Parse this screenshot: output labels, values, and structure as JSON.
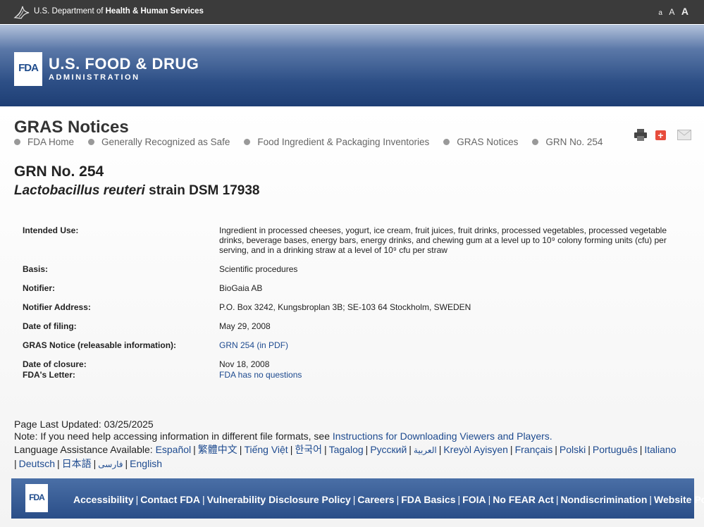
{
  "topbar": {
    "dept_prefix": "U.S. Department of ",
    "dept_name": "Health & Human Services",
    "font_sizes": [
      "a",
      "A",
      "A"
    ]
  },
  "banner": {
    "logo_text": "FDA",
    "title": "U.S. FOOD & DRUG",
    "subtitle": "ADMINISTRATION"
  },
  "page": {
    "title": "GRAS Notices",
    "breadcrumb": [
      "FDA Home",
      "Generally Recognized as Safe",
      "Food Ingredient & Packaging Inventories",
      "GRAS Notices",
      "GRN No. 254"
    ],
    "tools": [
      "print-icon",
      "plus-icon",
      "mail-icon"
    ],
    "grn_number": "GRN No. 254",
    "substance_italic": "Lactobacillus reuteri",
    "substance_rest": " strain DSM 17938"
  },
  "details": {
    "intended_use_label": "Intended Use:",
    "intended_use_line1": "Ingredient in processed cheeses, yogurt, ice cream, fruit juices, fruit drinks, processed vegetables, processed vegetable",
    "intended_use_line2": "drinks, beverage bases, energy bars, energy drinks, and chewing gum at a level up to 10⁹ colony forming units (cfu) per",
    "intended_use_line3": "serving, and in a drinking straw at a level of 10⁹ cfu per straw",
    "basis_label": "Basis:",
    "basis_value": "Scientific procedures",
    "notifier_label": "Notifier:",
    "notifier_value": "BioGaia AB",
    "address_label": "Notifier Address:",
    "address_value": "P.O. Box 3242, Kungsbroplan 3B; SE-103 64 Stockholm, SWEDEN",
    "filing_label": "Date of filing:",
    "filing_value": "May 29, 2008",
    "notice_label": "GRAS Notice (releasable information):",
    "notice_link": "GRN 254 (in PDF)",
    "closure_label": "Date of closure:",
    "closure_value": "Nov 18, 2008",
    "letter_label": "FDA's Letter:",
    "letter_link": "FDA has no questions"
  },
  "footer_info": {
    "updated": "Page Last Updated: 03/25/2025",
    "note_prefix": "Note: If you need help accessing information in different file formats, see ",
    "note_link": "Instructions for Downloading Viewers and Players.",
    "lang_label": "Language Assistance Available: ",
    "languages": [
      "Español",
      "繁體中文",
      "Tiếng Việt",
      "한국어",
      "Tagalog",
      "Русский",
      "العربية",
      "Kreyòl Ayisyen",
      "Français",
      "Polski",
      "Português",
      "Italiano",
      "Deutsch",
      "日本語",
      "فارسی",
      "English"
    ]
  },
  "footbar": {
    "logo_text": "FDA",
    "links": [
      "Accessibility",
      "Contact FDA",
      "Vulnerability Disclosure Policy",
      "Careers",
      "FDA Basics",
      "FOIA",
      "No FEAR Act",
      "Nondiscrimination",
      "Website Policies"
    ]
  }
}
